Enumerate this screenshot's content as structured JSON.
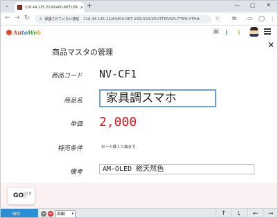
{
  "browser": {
    "tab_title": "218.44.135.22/AS400-NET.USR/",
    "tab_close": "×",
    "new_tab": "+",
    "dropdown": "⌄",
    "window_controls": [
      "—",
      "▢",
      "✕"
    ],
    "nav": {
      "back": "←",
      "forward": "→",
      "reload": "↻"
    },
    "security_warning_icon": "⚠",
    "security_label": "保護されていない通信",
    "url": "218.44.135.22/AS400-NET.USR/USR/SPLITTER/SPLITTER.HTM#"
  },
  "app": {
    "logo_text": "AutoWeb",
    "logo_colors": [
      "#e34a2f",
      "#2e7bd3",
      "#3aa53a",
      "#f5a623"
    ],
    "header_icons": [
      "panel-icon",
      "download-icon",
      "upload-icon",
      "avatar",
      "menu-icon"
    ]
  },
  "page": {
    "title": "商品マスタの管理",
    "close_label": "✕",
    "fields": {
      "code": {
        "label": "商品コード",
        "value": "NV-CF1"
      },
      "name": {
        "label": "商品名",
        "value": "家具調スマホ"
      },
      "price": {
        "label": "単価",
        "value": "2,000",
        "color": "#e0141e"
      },
      "special": {
        "label": "特売条件",
        "value": "お一人様１０個まで"
      },
      "note": {
        "label": "備考",
        "value": "AM-OLED 総天然色"
      }
    }
  },
  "action": {
    "go_label": "GO",
    "go_sub": "GO 実行"
  },
  "bottombar": {
    "go_tab": "GO",
    "zoom_minus": "−",
    "zoom_plus": "+",
    "zoom_value": "自動",
    "zoom_caret": "▾",
    "arrows": [
      "↑",
      "↓",
      "←",
      "→"
    ]
  },
  "colors": {
    "accent_blue": "#2b8fd6",
    "input_focus": "#6d9fd2",
    "go_area_bg": "#fbf1f3"
  }
}
